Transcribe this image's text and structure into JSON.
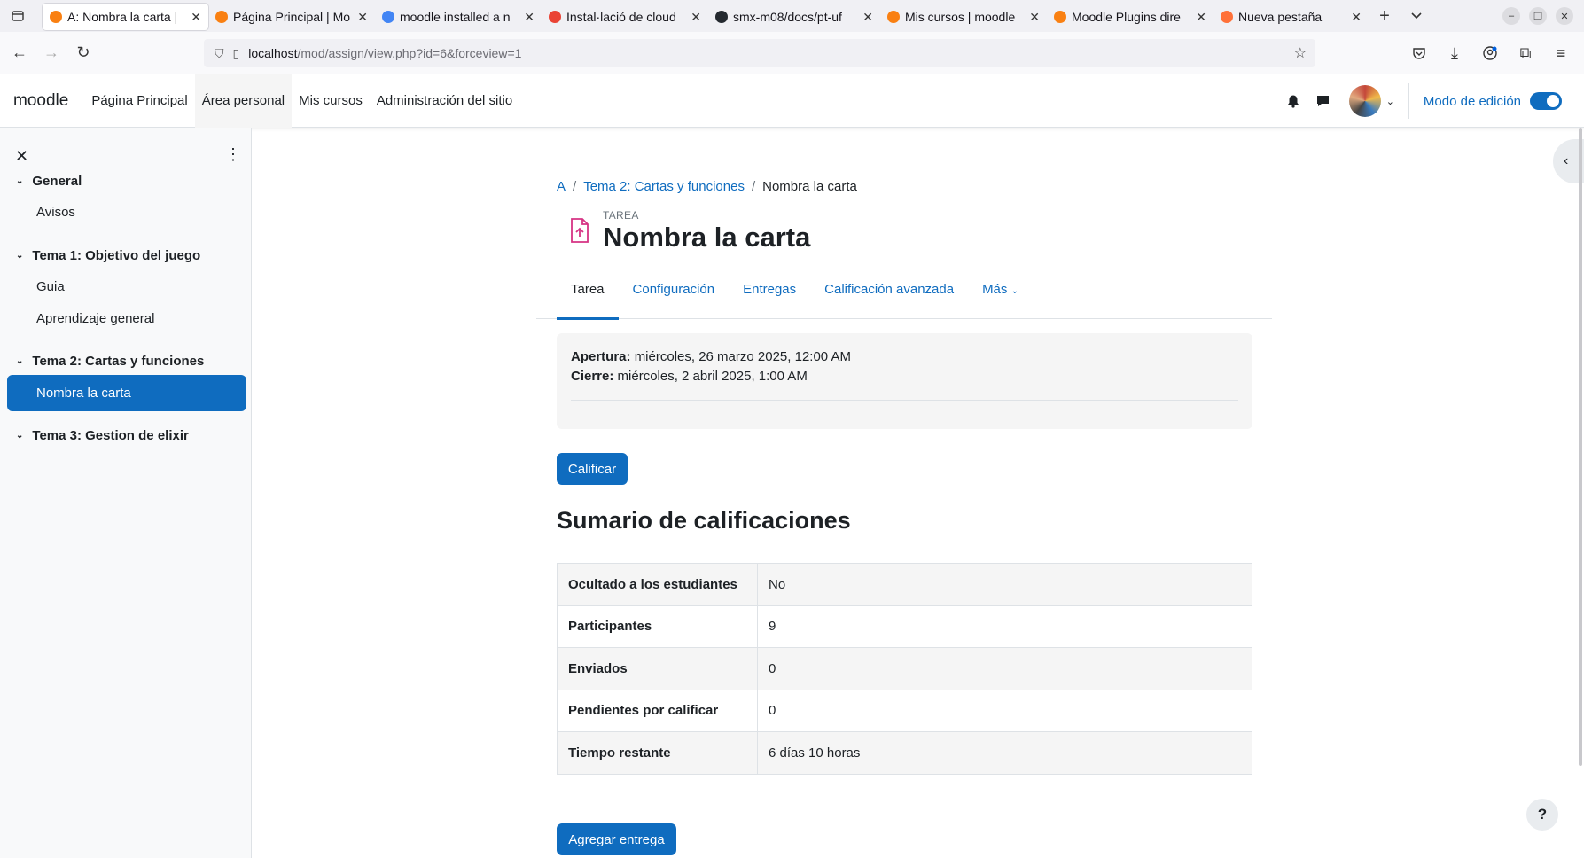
{
  "browser": {
    "tabs": [
      {
        "title": "A: Nombra la carta |",
        "fav": "moodle-tab-icon",
        "color": "#f98012",
        "active": true
      },
      {
        "title": "Página Principal | Mo",
        "fav": "moodle-orange-icon",
        "color": "#f98012",
        "active": false
      },
      {
        "title": "moodle installed a n",
        "fav": "google-icon",
        "color": "#4285f4",
        "active": false
      },
      {
        "title": "Instal·lació de cloud",
        "fav": "gmail-icon",
        "color": "#ea4335",
        "active": false
      },
      {
        "title": "smx-m08/docs/pt-uf",
        "fav": "github-icon",
        "color": "#24292f",
        "active": false
      },
      {
        "title": "Mis cursos | moodle",
        "fav": "moodle-tab-icon",
        "color": "#f98012",
        "active": false
      },
      {
        "title": "Moodle Plugins dire",
        "fav": "moodle-orange-icon",
        "color": "#f98012",
        "active": false
      },
      {
        "title": "Nueva pestaña",
        "fav": "firefox-icon",
        "color": "#ff7139",
        "active": false
      }
    ],
    "url_host": "localhost",
    "url_path": "/mod/assign/view.php?id=6&forceview=1"
  },
  "header": {
    "brand": "moodle",
    "nav": [
      {
        "label": "Página Principal",
        "active": false
      },
      {
        "label": "Área personal",
        "active": true
      },
      {
        "label": "Mis cursos",
        "active": false
      },
      {
        "label": "Administración del sitio",
        "active": false
      }
    ],
    "edit_mode_label": "Modo de edición",
    "edit_mode_on": true
  },
  "drawer": {
    "sections": [
      {
        "title": "General",
        "items": [
          "Avisos"
        ]
      },
      {
        "title": "Tema 1: Objetivo del juego",
        "items": [
          "Guia",
          "Aprendizaje general"
        ]
      },
      {
        "title": "Tema 2: Cartas y funciones",
        "items": [
          "Nombra la carta"
        ]
      },
      {
        "title": "Tema 3: Gestion de elixir",
        "items": []
      }
    ],
    "active_item": "Nombra la carta"
  },
  "breadcrumb": {
    "root": "A",
    "section": "Tema 2: Cartas y funciones",
    "current": "Nombra la carta"
  },
  "activity": {
    "type_label": "TAREA",
    "title": "Nombra la carta"
  },
  "secondary_nav": {
    "tarea": "Tarea",
    "configuracion": "Configuración",
    "entregas": "Entregas",
    "calificacion": "Calificación avanzada",
    "mas": "Más"
  },
  "dates": {
    "open_label": "Apertura:",
    "open_value": "miércoles, 26 marzo 2025, 12:00 AM",
    "close_label": "Cierre:",
    "close_value": "miércoles, 2 abril 2025, 1:00 AM"
  },
  "grade_button": "Calificar",
  "summary": {
    "heading": "Sumario de calificaciones",
    "rows": [
      {
        "label": "Ocultado a los estudiantes",
        "value": "No"
      },
      {
        "label": "Participantes",
        "value": "9"
      },
      {
        "label": "Enviados",
        "value": "0"
      },
      {
        "label": "Pendientes por calificar",
        "value": "0"
      },
      {
        "label": "Tiempo restante",
        "value": "6 días 10 horas"
      }
    ]
  },
  "add_submission_button": "Agregar entrega",
  "help_label": "?",
  "colors": {
    "primary": "#0f6cbf",
    "assign_icon": "#d63384"
  }
}
